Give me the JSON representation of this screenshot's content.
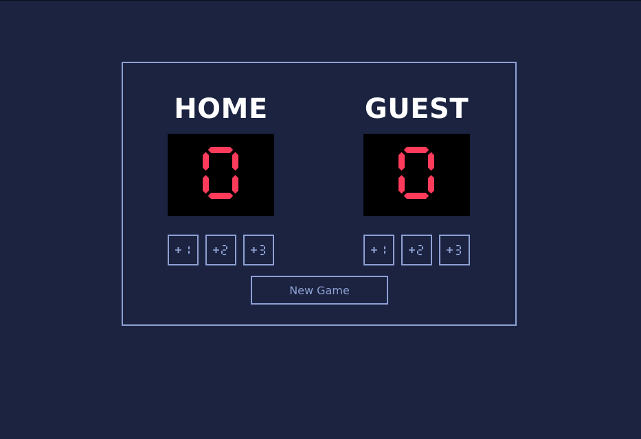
{
  "home": {
    "name": "HOME",
    "score": "0",
    "buttons": [
      "+1",
      "+2",
      "+3"
    ]
  },
  "guest": {
    "name": "GUEST",
    "score": "0",
    "buttons": [
      "+1",
      "+2",
      "+3"
    ]
  },
  "new_game_label": "New Game",
  "colors": {
    "background": "#1b2341",
    "accent": "#8fa1d4",
    "score_digit": "#ff3b5c",
    "display_bg": "#000000",
    "team_name": "#ffffff"
  }
}
